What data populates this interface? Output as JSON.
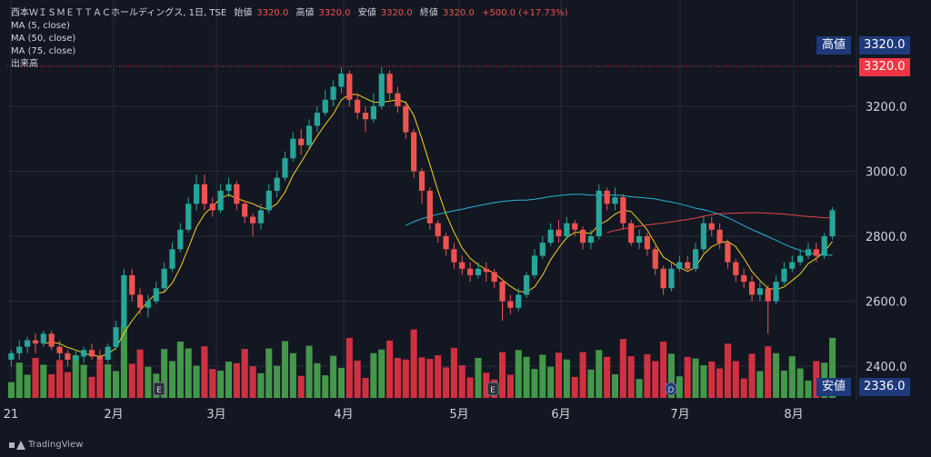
{
  "legend": {
    "symbol": "西本ＷＩＳＭＥＴＴＡＣホールディングス, 1日, TSE",
    "open_label": "始値",
    "open": "3320.0",
    "high_label": "高値",
    "high": "3320.0",
    "low_label": "安値",
    "low": "3320.0",
    "close_label": "終値",
    "close": "3320.0",
    "change": "+500.0 (+17.73%)",
    "ma5": "MA (5, close)",
    "ma50": "MA (50, close)",
    "ma75": "MA (75, close)",
    "volume": "出来高"
  },
  "tags": {
    "high_label": "高値",
    "high_value": "3320.0",
    "last_value": "3320.0",
    "low_label": "安値",
    "low_value": "2336.0"
  },
  "brand": "TradingView",
  "colors": {
    "up": "#26a69a",
    "down": "#ef5350",
    "vol_up": "#4caf50",
    "vol_down": "#f23645",
    "ma5": "#f5d320",
    "ma50": "#26b6d6",
    "ma75": "#e04848",
    "bg": "#131722"
  },
  "chart_data": {
    "type": "candlestick",
    "y_axis": {
      "min": 2336,
      "max": 3320,
      "ticks": [
        2400,
        2600,
        2800,
        3000,
        3200
      ],
      "tick_labels": [
        "2400.0",
        "2600.0",
        "2800.0",
        "3000.0",
        "3200.0"
      ]
    },
    "x_labels": [
      "21",
      "2月",
      "3月",
      "4月",
      "5月",
      "6月",
      "7月",
      "8月"
    ],
    "events": [
      "E",
      "E",
      "D"
    ],
    "candles": [
      [
        2420,
        2440,
        2400,
        2450
      ],
      [
        2440,
        2460,
        2420,
        2480
      ],
      [
        2460,
        2480,
        2440,
        2490
      ],
      [
        2480,
        2470,
        2440,
        2500
      ],
      [
        2470,
        2500,
        2460,
        2510
      ],
      [
        2500,
        2460,
        2450,
        2510
      ],
      [
        2460,
        2440,
        2420,
        2480
      ],
      [
        2440,
        2420,
        2400,
        2450
      ],
      [
        2420,
        2430,
        2400,
        2450
      ],
      [
        2430,
        2450,
        2410,
        2460
      ],
      [
        2450,
        2430,
        2420,
        2470
      ],
      [
        2430,
        2420,
        2410,
        2450
      ],
      [
        2420,
        2460,
        2410,
        2470
      ],
      [
        2460,
        2520,
        2450,
        2540
      ],
      [
        2520,
        2680,
        2510,
        2700
      ],
      [
        2680,
        2620,
        2600,
        2700
      ],
      [
        2620,
        2580,
        2560,
        2640
      ],
      [
        2580,
        2600,
        2550,
        2620
      ],
      [
        2600,
        2640,
        2590,
        2660
      ],
      [
        2640,
        2700,
        2630,
        2720
      ],
      [
        2700,
        2760,
        2690,
        2780
      ],
      [
        2760,
        2820,
        2750,
        2840
      ],
      [
        2820,
        2900,
        2810,
        2920
      ],
      [
        2900,
        2960,
        2880,
        2990
      ],
      [
        2960,
        2900,
        2880,
        2990
      ],
      [
        2900,
        2880,
        2860,
        2920
      ],
      [
        2880,
        2940,
        2870,
        2960
      ],
      [
        2940,
        2960,
        2920,
        2980
      ],
      [
        2960,
        2900,
        2880,
        2970
      ],
      [
        2900,
        2860,
        2840,
        2910
      ],
      [
        2860,
        2840,
        2800,
        2870
      ],
      [
        2840,
        2880,
        2820,
        2900
      ],
      [
        2880,
        2940,
        2870,
        2960
      ],
      [
        2940,
        2980,
        2920,
        3000
      ],
      [
        2980,
        3040,
        2970,
        3060
      ],
      [
        3040,
        3100,
        3030,
        3120
      ],
      [
        3100,
        3080,
        3050,
        3130
      ],
      [
        3080,
        3140,
        3070,
        3160
      ],
      [
        3140,
        3180,
        3120,
        3200
      ],
      [
        3180,
        3220,
        3170,
        3250
      ],
      [
        3220,
        3260,
        3200,
        3280
      ],
      [
        3260,
        3300,
        3240,
        3320
      ],
      [
        3300,
        3220,
        3200,
        3310
      ],
      [
        3220,
        3180,
        3160,
        3240
      ],
      [
        3180,
        3160,
        3120,
        3200
      ],
      [
        3160,
        3200,
        3150,
        3240
      ],
      [
        3200,
        3300,
        3190,
        3320
      ],
      [
        3300,
        3240,
        3220,
        3310
      ],
      [
        3240,
        3200,
        3180,
        3260
      ],
      [
        3200,
        3120,
        3100,
        3210
      ],
      [
        3120,
        3000,
        2980,
        3130
      ],
      [
        3000,
        2940,
        2900,
        3010
      ],
      [
        2940,
        2840,
        2820,
        2950
      ],
      [
        2840,
        2800,
        2780,
        2850
      ],
      [
        2800,
        2760,
        2740,
        2810
      ],
      [
        2760,
        2720,
        2700,
        2780
      ],
      [
        2720,
        2700,
        2680,
        2740
      ],
      [
        2700,
        2680,
        2660,
        2720
      ],
      [
        2680,
        2700,
        2670,
        2720
      ],
      [
        2700,
        2690,
        2660,
        2720
      ],
      [
        2690,
        2660,
        2640,
        2700
      ],
      [
        2660,
        2600,
        2540,
        2670
      ],
      [
        2600,
        2580,
        2560,
        2620
      ],
      [
        2580,
        2620,
        2570,
        2640
      ],
      [
        2620,
        2680,
        2610,
        2690
      ],
      [
        2680,
        2740,
        2670,
        2760
      ],
      [
        2740,
        2780,
        2730,
        2800
      ],
      [
        2780,
        2820,
        2770,
        2840
      ],
      [
        2820,
        2800,
        2780,
        2850
      ],
      [
        2800,
        2840,
        2790,
        2860
      ],
      [
        2840,
        2820,
        2800,
        2850
      ],
      [
        2820,
        2780,
        2760,
        2830
      ],
      [
        2780,
        2800,
        2760,
        2820
      ],
      [
        2800,
        2940,
        2790,
        2960
      ],
      [
        2940,
        2900,
        2880,
        2950
      ],
      [
        2900,
        2920,
        2880,
        2950
      ],
      [
        2920,
        2840,
        2820,
        2930
      ],
      [
        2840,
        2780,
        2770,
        2850
      ],
      [
        2780,
        2800,
        2760,
        2820
      ],
      [
        2800,
        2760,
        2740,
        2810
      ],
      [
        2760,
        2700,
        2680,
        2770
      ],
      [
        2700,
        2640,
        2620,
        2710
      ],
      [
        2640,
        2700,
        2630,
        2720
      ],
      [
        2700,
        2720,
        2690,
        2740
      ],
      [
        2720,
        2700,
        2690,
        2740
      ],
      [
        2700,
        2760,
        2690,
        2780
      ],
      [
        2760,
        2840,
        2750,
        2860
      ],
      [
        2840,
        2820,
        2800,
        2860
      ],
      [
        2820,
        2780,
        2760,
        2840
      ],
      [
        2780,
        2720,
        2700,
        2790
      ],
      [
        2720,
        2680,
        2660,
        2730
      ],
      [
        2680,
        2660,
        2640,
        2700
      ],
      [
        2660,
        2620,
        2600,
        2680
      ],
      [
        2620,
        2640,
        2600,
        2660
      ],
      [
        2640,
        2600,
        2500,
        2650
      ],
      [
        2600,
        2660,
        2590,
        2680
      ],
      [
        2660,
        2700,
        2650,
        2720
      ],
      [
        2700,
        2720,
        2690,
        2740
      ],
      [
        2720,
        2740,
        2710,
        2760
      ],
      [
        2740,
        2760,
        2730,
        2780
      ],
      [
        2760,
        2740,
        2720,
        2780
      ],
      [
        2740,
        2800,
        2730,
        2810
      ],
      [
        2800,
        2880,
        2790,
        2890
      ]
    ]
  }
}
